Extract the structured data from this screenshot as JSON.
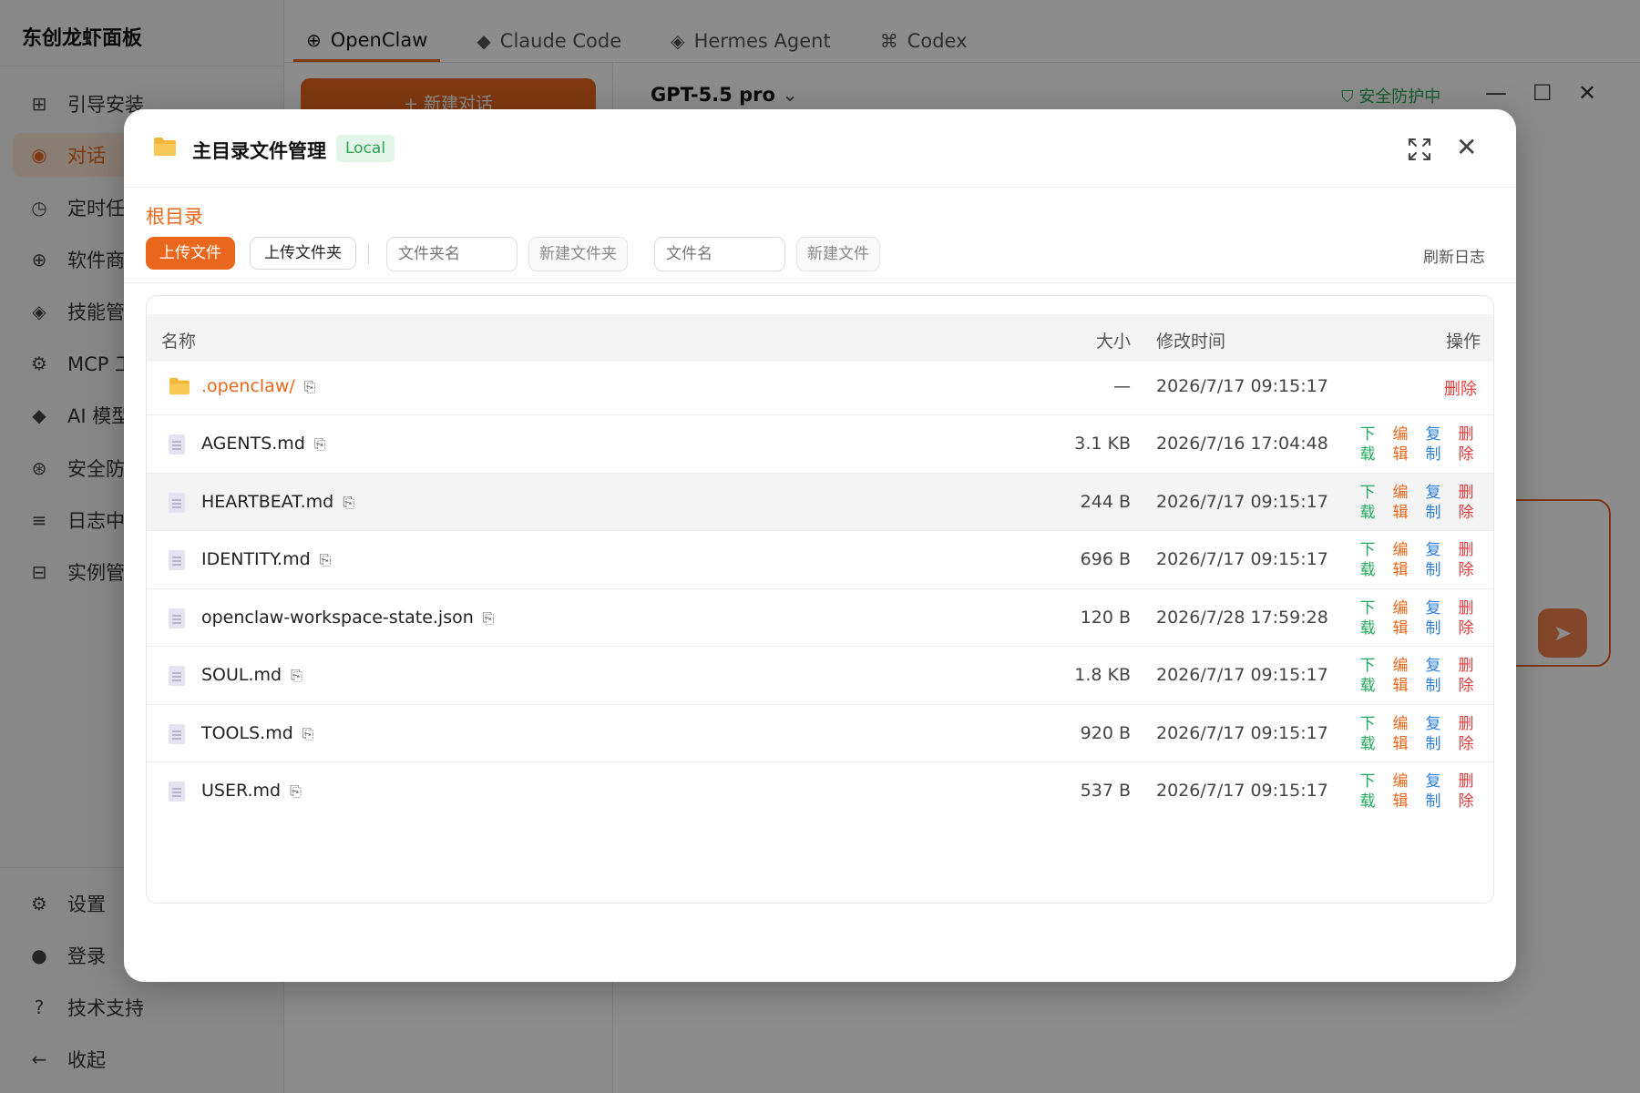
{
  "app": {
    "brand": "东创龙虾面板",
    "sidebar": {
      "items": [
        {
          "icon": "grid-icon",
          "label": "引导安装"
        },
        {
          "icon": "chat-icon",
          "label": "对话"
        },
        {
          "icon": "clock-icon",
          "label": "定时任"
        },
        {
          "icon": "store-icon",
          "label": "软件商"
        },
        {
          "icon": "diamond-icon",
          "label": "技能管"
        },
        {
          "icon": "gear-icon",
          "label": "MCP 工"
        },
        {
          "icon": "sparkle-icon",
          "label": "AI 模型"
        },
        {
          "icon": "shield-icon",
          "label": "安全防"
        },
        {
          "icon": "list-icon",
          "label": "日志中"
        },
        {
          "icon": "instance-icon",
          "label": "实例管"
        }
      ],
      "bottom_items": [
        {
          "icon": "settings-icon",
          "label": "设置"
        },
        {
          "icon": "user-icon",
          "label": "登录"
        },
        {
          "icon": "help-icon",
          "label": "技术支持"
        },
        {
          "icon": "collapse-icon",
          "label": "收起"
        }
      ]
    },
    "tabs": [
      {
        "icon": "globe-icon",
        "label": "OpenClaw"
      },
      {
        "icon": "dot-icon",
        "label": "Claude Code"
      },
      {
        "icon": "diamond-icon",
        "label": "Hermes Agent"
      },
      {
        "icon": "command-icon",
        "label": "Codex"
      }
    ],
    "new_chat_label": "+ 新建对话",
    "model": "GPT-5.5 pro",
    "security_status": "安全防护中",
    "accent_color": "#e8671c"
  },
  "modal": {
    "title": "主目录文件管理",
    "badge": "Local",
    "breadcrumb": "根目录",
    "toolbar": {
      "upload_file": "上传文件",
      "upload_folder": "上传文件夹",
      "folder_name_placeholder": "文件夹名",
      "new_folder": "新建文件夹",
      "file_name_placeholder": "文件名",
      "new_file": "新建文件",
      "refresh_log": "刷新日志"
    },
    "table": {
      "headers": {
        "name": "名称",
        "size": "大小",
        "modified": "修改时间",
        "actions": "操作"
      },
      "action_labels": {
        "download": [
          "下",
          "载"
        ],
        "edit": [
          "编",
          "辑"
        ],
        "copy": [
          "复",
          "制"
        ],
        "delete": [
          "删",
          "除"
        ]
      },
      "folder_row": {
        "name": ".openclaw/",
        "size": "—",
        "modified": "2026/7/17 09:15:17",
        "delete": "删除"
      },
      "rows": [
        {
          "name": "AGENTS.md",
          "size": "3.1 KB",
          "modified": "2026/7/16 17:04:48"
        },
        {
          "name": "HEARTBEAT.md",
          "size": "244 B",
          "modified": "2026/7/17 09:15:17"
        },
        {
          "name": "IDENTITY.md",
          "size": "696 B",
          "modified": "2026/7/17 09:15:17"
        },
        {
          "name": "openclaw-workspace-state.json",
          "size": "120 B",
          "modified": "2026/7/28 17:59:28"
        },
        {
          "name": "SOUL.md",
          "size": "1.8 KB",
          "modified": "2026/7/17 09:15:17"
        },
        {
          "name": "TOOLS.md",
          "size": "920 B",
          "modified": "2026/7/17 09:15:17"
        },
        {
          "name": "USER.md",
          "size": "537 B",
          "modified": "2026/7/17 09:15:17"
        }
      ]
    }
  }
}
